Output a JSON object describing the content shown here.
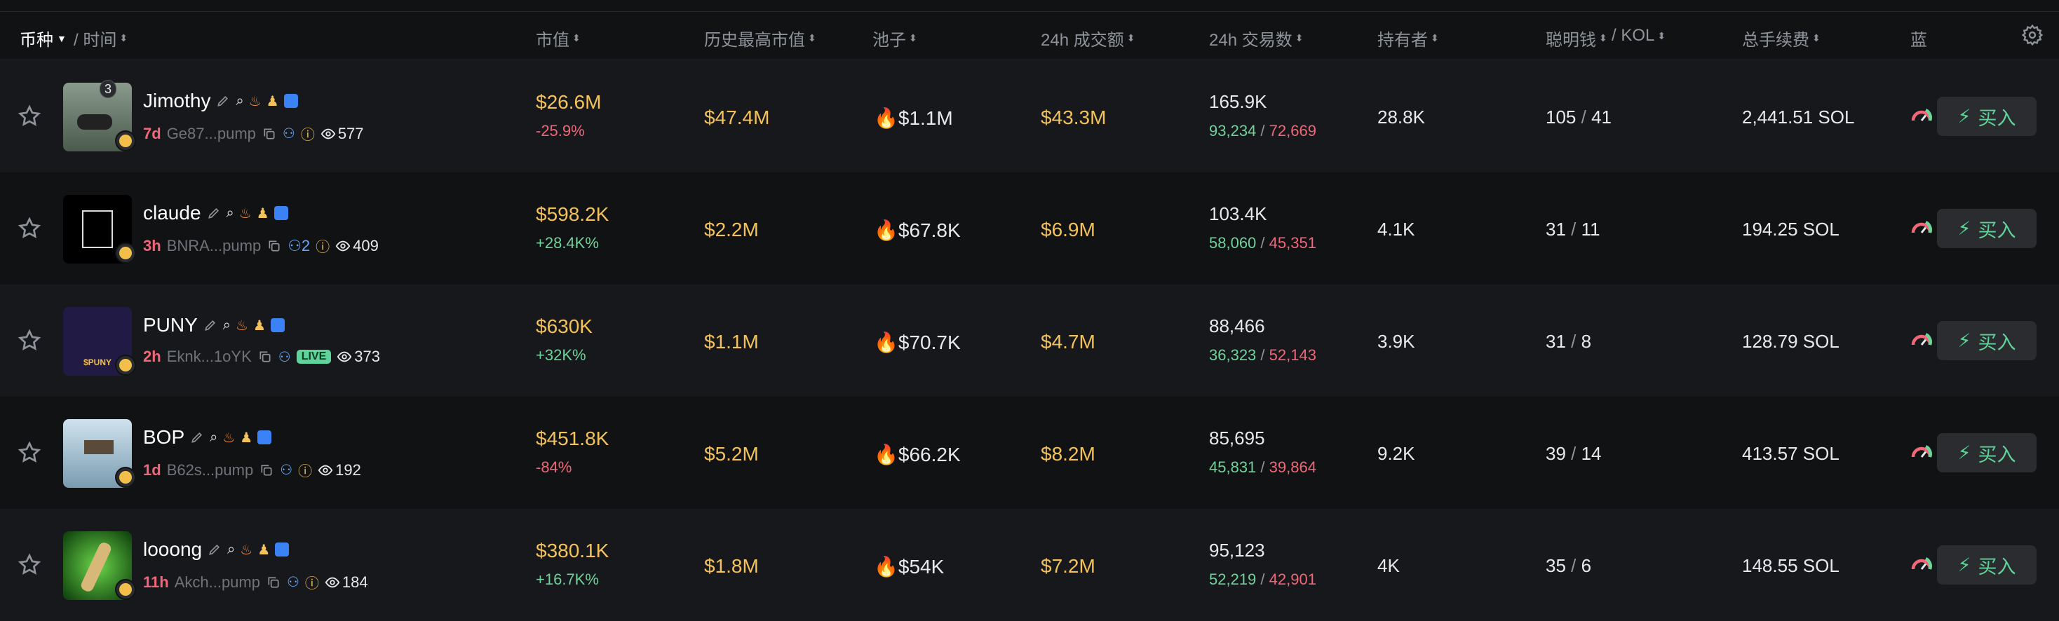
{
  "header": {
    "coin_label": "币种",
    "time_label": "/ 时间",
    "columns": [
      "市值",
      "历史最高市值",
      "池子",
      "24h 成交额",
      "24h 交易数",
      "持有者",
      "聪明钱",
      "/ KOL",
      "总手续费",
      "蓝"
    ]
  },
  "colors": {
    "positive": "#6fd39a",
    "negative": "#f0677a",
    "value": "#f3c25a",
    "buy": "#5ed49a"
  },
  "rows": [
    {
      "name": "Jimothy",
      "age": "7d",
      "addr": "Ge87...pump",
      "views": "577",
      "count_badge": "3",
      "mcap": "$26.6M",
      "mcap_change": "-25.9%",
      "ath": "$47.4M",
      "pool": "$1.1M",
      "volume": "$43.3M",
      "txns": "165.9K",
      "buys": "93,234",
      "sells": "72,669",
      "holders": "28.8K",
      "smart": "105",
      "kol": "41",
      "fees": "2,441.51 SOL",
      "buy": "买入"
    },
    {
      "name": "claude",
      "age": "3h",
      "addr": "BNRA...pump",
      "views": "409",
      "holder_count": "2",
      "mcap": "$598.2K",
      "mcap_change": "+28.4K%",
      "ath": "$2.2M",
      "pool": "$67.8K",
      "volume": "$6.9M",
      "txns": "103.4K",
      "buys": "58,060",
      "sells": "45,351",
      "holders": "4.1K",
      "smart": "31",
      "kol": "11",
      "fees": "194.25 SOL",
      "buy": "买入"
    },
    {
      "name": "PUNY",
      "age": "2h",
      "addr": "Eknk...1oYK",
      "views": "373",
      "live": "LIVE",
      "mcap": "$630K",
      "mcap_change": "+32K%",
      "ath": "$1.1M",
      "pool": "$70.7K",
      "volume": "$4.7M",
      "txns": "88,466",
      "buys": "36,323",
      "sells": "52,143",
      "holders": "3.9K",
      "smart": "31",
      "kol": "8",
      "fees": "128.79 SOL",
      "buy": "买入"
    },
    {
      "name": "BOP",
      "age": "1d",
      "addr": "B62s...pump",
      "views": "192",
      "mcap": "$451.8K",
      "mcap_change": "-84%",
      "ath": "$5.2M",
      "pool": "$66.2K",
      "volume": "$8.2M",
      "txns": "85,695",
      "buys": "45,831",
      "sells": "39,864",
      "holders": "9.2K",
      "smart": "39",
      "kol": "14",
      "fees": "413.57 SOL",
      "buy": "买入"
    },
    {
      "name": "looong",
      "age": "11h",
      "addr": "Akch...pump",
      "views": "184",
      "mcap": "$380.1K",
      "mcap_change": "+16.7K%",
      "ath": "$1.8M",
      "pool": "$54K",
      "volume": "$7.2M",
      "txns": "95,123",
      "buys": "52,219",
      "sells": "42,901",
      "holders": "4K",
      "smart": "35",
      "kol": "6",
      "fees": "148.55 SOL",
      "buy": "买入"
    }
  ],
  "avatar_art": {
    "row2_text": "$PUNY"
  }
}
